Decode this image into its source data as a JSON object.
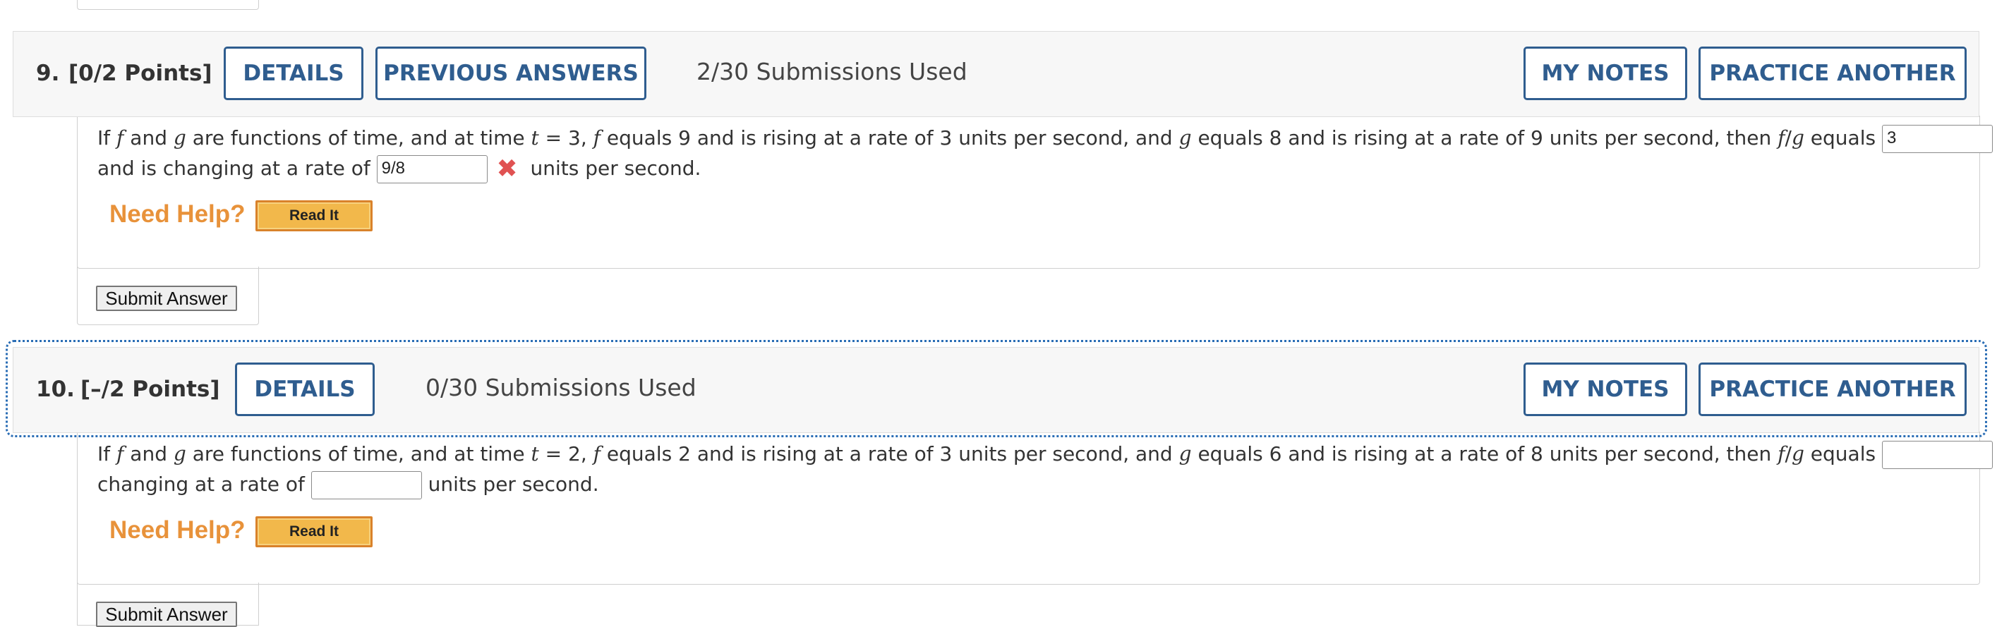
{
  "q9": {
    "number": "9.",
    "points": "[0/2 Points]",
    "details_label": "DETAILS",
    "previous_answers_label": "PREVIOUS ANSWERS",
    "submissions": "2/30 Submissions Used",
    "my_notes_label": "MY NOTES",
    "practice_label": "PRACTICE ANOTHER",
    "answer1": "3",
    "answer2": "9/8",
    "answer1_status": "incorrect",
    "answer2_status": "incorrect",
    "need_help": "Need Help?",
    "read_it": "Read It",
    "submit_label": "Submit Answer"
  },
  "q10": {
    "number": "10.",
    "points": "[–/2 Points]",
    "details_label": "DETAILS",
    "submissions": "0/30 Submissions Used",
    "my_notes_label": "MY NOTES",
    "practice_label": "PRACTICE ANOTHER",
    "answer1": "",
    "answer2": "",
    "need_help": "Need Help?",
    "read_it": "Read It",
    "submit_label": "Submit Answer"
  },
  "colors": {
    "accent": "#2f5d8f",
    "help": "#e8923a",
    "error": "#e05252",
    "focus": "#2a6db5"
  },
  "icons": {
    "incorrect": "x-mark-icon"
  }
}
